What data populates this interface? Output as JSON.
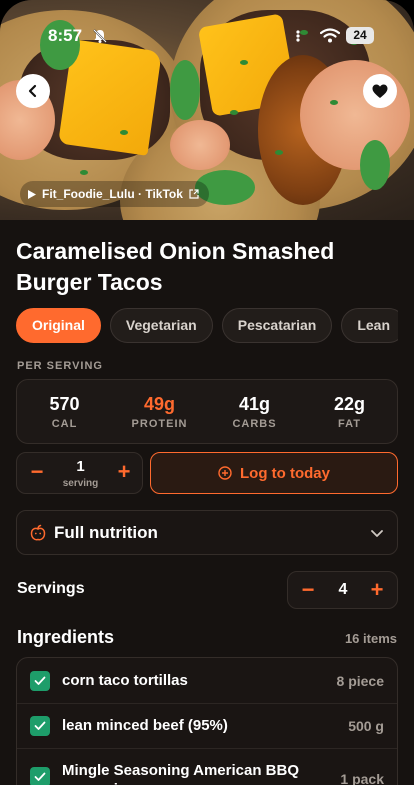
{
  "status_bar": {
    "time": "8:57",
    "battery": "24"
  },
  "hero": {
    "source": "Fit_Foodie_Lulu · TikTok"
  },
  "recipe": {
    "title": "Caramelised Onion Smashed Burger Tacos"
  },
  "variants": [
    {
      "label": "Original",
      "active": true
    },
    {
      "label": "Vegetarian",
      "active": false
    },
    {
      "label": "Pescatarian",
      "active": false
    },
    {
      "label": "Lean",
      "active": false
    }
  ],
  "per_serving": {
    "label": "PER SERVING",
    "stats": [
      {
        "value": "570",
        "label": "CAL"
      },
      {
        "value": "49g",
        "label": "PROTEIN"
      },
      {
        "value": "41g",
        "label": "CARBS"
      },
      {
        "value": "22g",
        "label": "FAT"
      }
    ]
  },
  "log": {
    "quantity": "1",
    "unit": "serving",
    "minus": "−",
    "plus": "+",
    "button_label": "Log to today"
  },
  "nutrition": {
    "label": "Full nutrition"
  },
  "servings": {
    "label": "Servings",
    "value": "4",
    "minus": "−",
    "plus": "+"
  },
  "ingredients": {
    "title": "Ingredients",
    "count": "16 items",
    "items": [
      {
        "name": "corn taco tortillas",
        "qty": "8 piece"
      },
      {
        "name": "lean minced beef (95%)",
        "qty": "500 g"
      },
      {
        "name": "Mingle Seasoning American BBQ seasoning",
        "qty": "1 pack"
      }
    ]
  },
  "colors": {
    "accent": "#ff6a2e",
    "check": "#1e9d6a",
    "background": "#161210"
  },
  "icons": [
    "bell-slash-icon",
    "wifi-icon",
    "back-chevron-icon",
    "heart-icon",
    "play-icon",
    "external-link-icon",
    "plus-circle-icon",
    "apple-icon",
    "chevron-down-icon",
    "check-icon"
  ]
}
